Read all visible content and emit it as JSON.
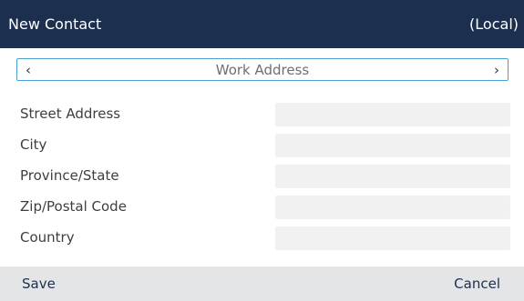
{
  "header": {
    "title": "New Contact",
    "location": "(Local)"
  },
  "selector": {
    "left_icon": "chevron-left-icon",
    "label": "Work Address",
    "right_icon": "chevron-right-icon",
    "left_glyph": "‹",
    "right_glyph": "›"
  },
  "form": {
    "fields": [
      {
        "label": "Street Address",
        "value": ""
      },
      {
        "label": "City",
        "value": ""
      },
      {
        "label": "Province/State",
        "value": ""
      },
      {
        "label": "Zip/Postal Code",
        "value": ""
      },
      {
        "label": "Country",
        "value": ""
      }
    ]
  },
  "softkeys": {
    "save": "Save",
    "cancel": "Cancel"
  },
  "colors": {
    "titlebar_bg": "#1c2f4f",
    "selector_border": "#4aa3d4",
    "field_bg": "#f1f1f1",
    "softkey_bar_bg": "#e4e5e7"
  }
}
